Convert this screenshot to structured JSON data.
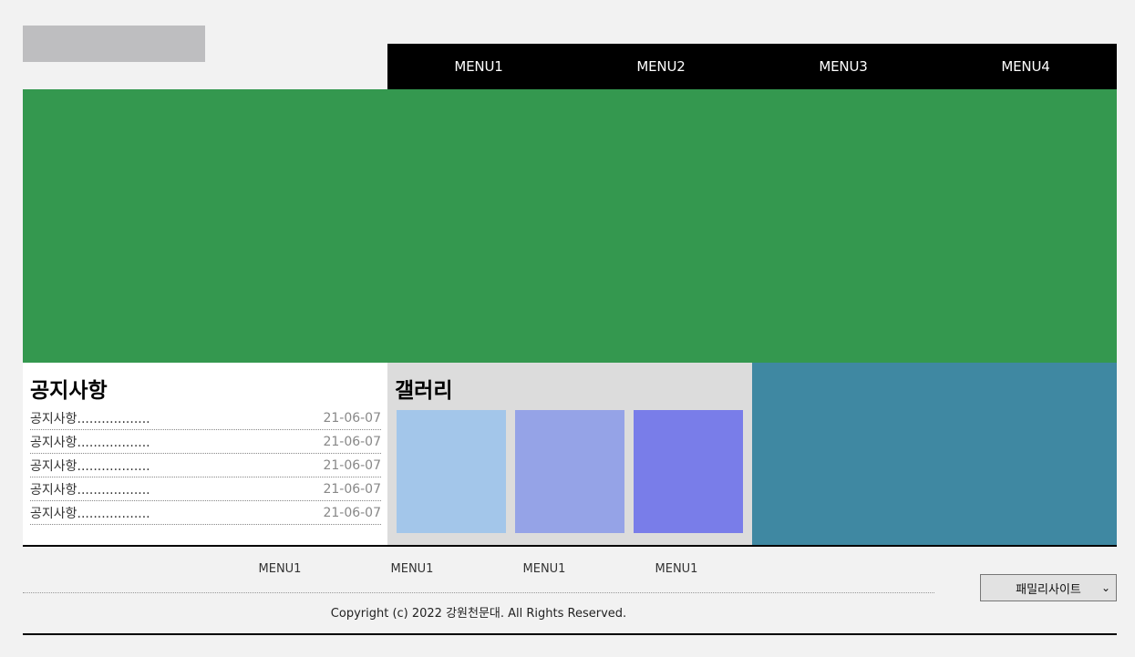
{
  "header": {
    "nav": [
      "MENU1",
      "MENU2",
      "MENU3",
      "MENU4"
    ]
  },
  "notice": {
    "title": "공지사항",
    "items": [
      {
        "title": "공지사항..................",
        "date": "21-06-07"
      },
      {
        "title": "공지사항..................",
        "date": "21-06-07"
      },
      {
        "title": "공지사항..................",
        "date": "21-06-07"
      },
      {
        "title": "공지사항..................",
        "date": "21-06-07"
      },
      {
        "title": "공지사항..................",
        "date": "21-06-07"
      }
    ]
  },
  "gallery": {
    "title": "갤러리",
    "thumb_colors": [
      "#a3c6ea",
      "#95a3e7",
      "#797de9"
    ]
  },
  "footer": {
    "nav": [
      "MENU1",
      "MENU1",
      "MENU1",
      "MENU1"
    ],
    "copyright": "Copyright (c) 2022 강원천문대. All Rights Reserved.",
    "family_select": "패밀리사이트"
  },
  "colors": {
    "hero": "#34984f",
    "banner": "#3f88a2",
    "nav_bg": "#000000",
    "logo": "#bebec0"
  }
}
